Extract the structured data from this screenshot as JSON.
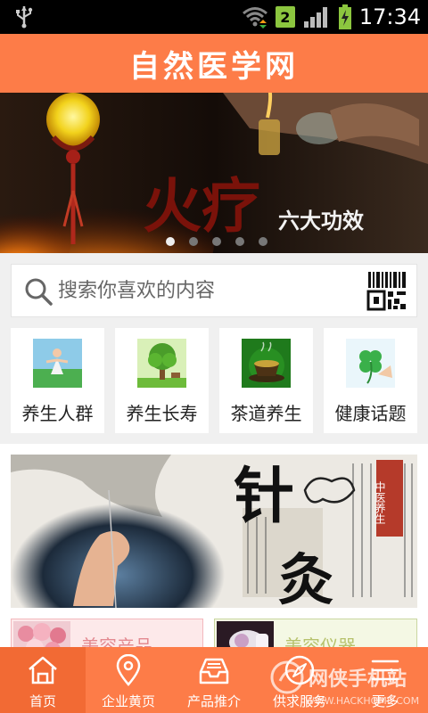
{
  "status_bar": {
    "notification_badge": "2",
    "time": "17:34",
    "icons": [
      "usb-icon",
      "wifi-icon",
      "signal-icon",
      "battery-charging-icon"
    ]
  },
  "header": {
    "title": "自然医学网"
  },
  "banner": {
    "slide_count": 5,
    "active_slide": 1,
    "text_main": "火疗",
    "text_sub": "六大功效"
  },
  "search": {
    "placeholder": "搜索你喜欢的内容",
    "value": "",
    "icons": [
      "search-icon",
      "qr-code-icon"
    ]
  },
  "categories": [
    {
      "label": "养生人群",
      "icon": "yoga-person-thumb"
    },
    {
      "label": "养生长寿",
      "icon": "tree-thumb"
    },
    {
      "label": "茶道养生",
      "icon": "tea-cup-thumb"
    },
    {
      "label": "健康话题",
      "icon": "clover-thumb"
    }
  ],
  "promo": {
    "text_main_1": "针",
    "text_main_2": "灸",
    "stamp_text": "中医养生"
  },
  "cards": [
    {
      "title": "美容产品"
    },
    {
      "title": "美容仪器"
    }
  ],
  "bottom_nav": [
    {
      "label": "首页",
      "icon": "home-icon",
      "active": true
    },
    {
      "label": "企业黄页",
      "icon": "location-pin-icon",
      "active": false
    },
    {
      "label": "产品推介",
      "icon": "inbox-tray-icon",
      "active": false
    },
    {
      "label": "供求服务",
      "icon": "compass-icon",
      "active": false
    },
    {
      "label": "更多",
      "icon": "menu-icon",
      "active": false
    }
  ],
  "watermark": {
    "text": "网侠手机站",
    "url": "WWW.HACKHOME.COM"
  },
  "colors": {
    "accent": "#fd7c48",
    "accent_active": "#f26a34",
    "background": "#f0f0f0"
  }
}
